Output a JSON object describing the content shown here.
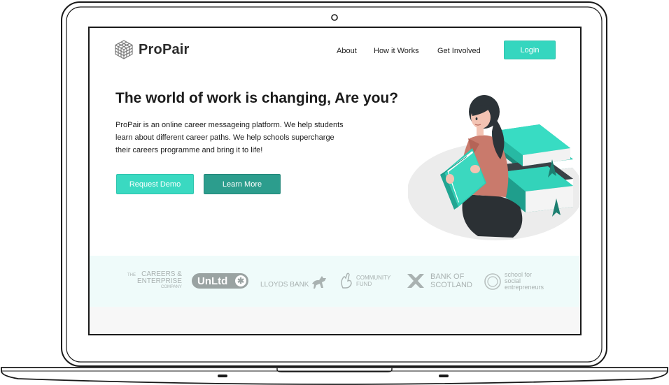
{
  "brand": {
    "name": "ProPair",
    "logo_icon": "cube-grid-icon"
  },
  "nav": {
    "links": [
      "About",
      "How it Works",
      "Get Involved"
    ],
    "login_label": "Login"
  },
  "hero": {
    "title": "The world of work is changing, Are you?",
    "description_lines": [
      "ProPair is an online career messageing platform.  We help students",
      "learn about different career paths. We help schools supercharge",
      "their careers programme and bring it to life!"
    ],
    "primary_button": "Request Demo",
    "secondary_button": "Learn More"
  },
  "partners": {
    "careers": {
      "small_top": "THE",
      "line1": "CAREERS &",
      "line2": "ENTERPRISE",
      "small_bottom": "COMPANY"
    },
    "unltd": {
      "label": "UnLtd",
      "icon": "star-icon"
    },
    "lloyds": {
      "label": "LLOYDS BANK",
      "icon": "horse-icon"
    },
    "community": {
      "line1": "COMMUNITY",
      "line2": "FUND",
      "icon": "crossed-fingers-icon"
    },
    "bos": {
      "line1": "BANK OF",
      "line2": "SCOTLAND",
      "icon": "saltire-icon"
    },
    "sse": {
      "line1": "school for",
      "line2": "social",
      "line3": "entrepreneurs",
      "icon": "ring-icon"
    }
  },
  "colors": {
    "accent": "#35d6bf",
    "accent_dark": "#2c9d8d",
    "partner_band": "#effbfa",
    "partner_logo": "#a9b2b1"
  }
}
